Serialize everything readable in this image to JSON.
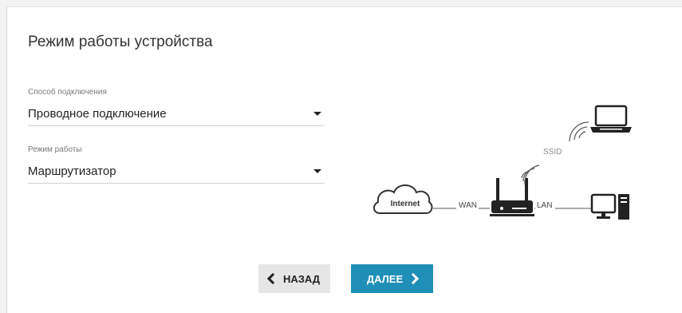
{
  "page": {
    "title": "Режим работы устройства"
  },
  "connection": {
    "label": "Способ подключения",
    "value": "Проводное подключение"
  },
  "mode": {
    "label": "Режим работы",
    "value": "Маршрутизатор"
  },
  "diagram": {
    "internet": "Internet",
    "wan": "WAN",
    "lan": "LAN",
    "ssid": "SSID",
    "icons": [
      "cloud-icon",
      "router-icon",
      "desktop-icon",
      "laptop-icon",
      "wifi-signal-icon"
    ]
  },
  "buttons": {
    "back": "НАЗАД",
    "next": "ДАЛЕЕ"
  },
  "colors": {
    "accent": "#1f8fb8",
    "back_button": "#e6e6e6"
  }
}
